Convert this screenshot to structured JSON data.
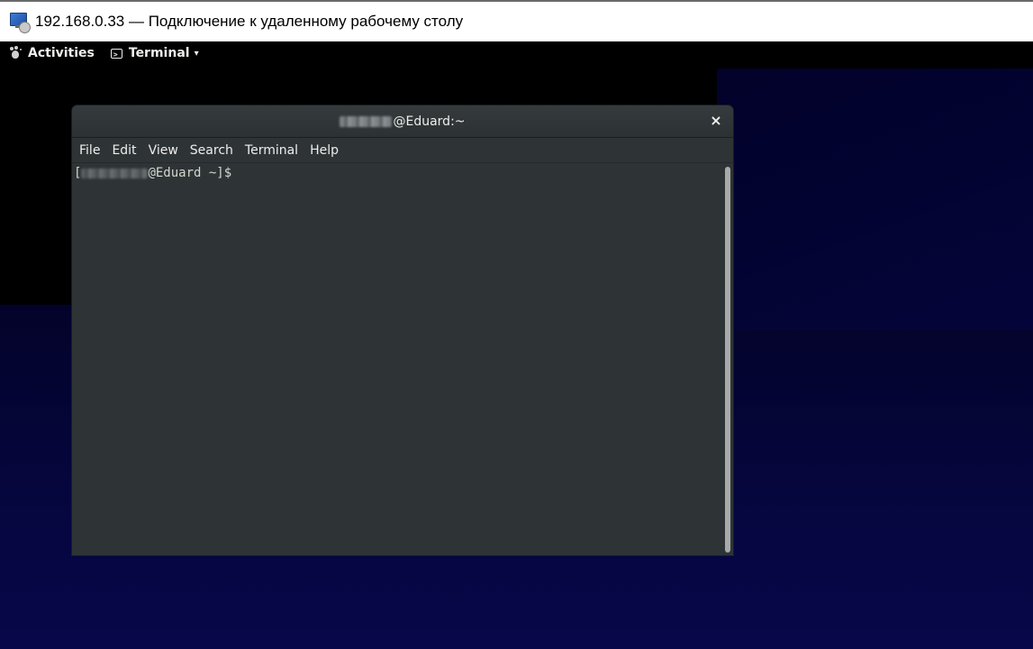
{
  "rdp_window": {
    "title": "192.168.0.33 — Подключение к удаленному рабочему столу",
    "icon": "remote-desktop-icon"
  },
  "gnome_topbar": {
    "activities_label": "Activities",
    "activities_icon": "gnome-foot-icon",
    "app_menu_label": "Terminal",
    "app_menu_icon": "terminal-icon",
    "app_menu_caret": "▾"
  },
  "terminal": {
    "title_host": "@Eduard:~",
    "close_glyph": "×",
    "menu": [
      {
        "label": "File"
      },
      {
        "label": "Edit"
      },
      {
        "label": "View"
      },
      {
        "label": "Search"
      },
      {
        "label": "Terminal"
      },
      {
        "label": "Help"
      }
    ],
    "prompt_open": "[",
    "prompt_host": "@Eduard ~]$",
    "scroll_fraction": 1.0
  },
  "colors": {
    "terminal_bg": "#2e3436",
    "terminal_fg": "#d3d7cf",
    "desktop_bg": "#000000",
    "desktop_band": "#06063f"
  }
}
